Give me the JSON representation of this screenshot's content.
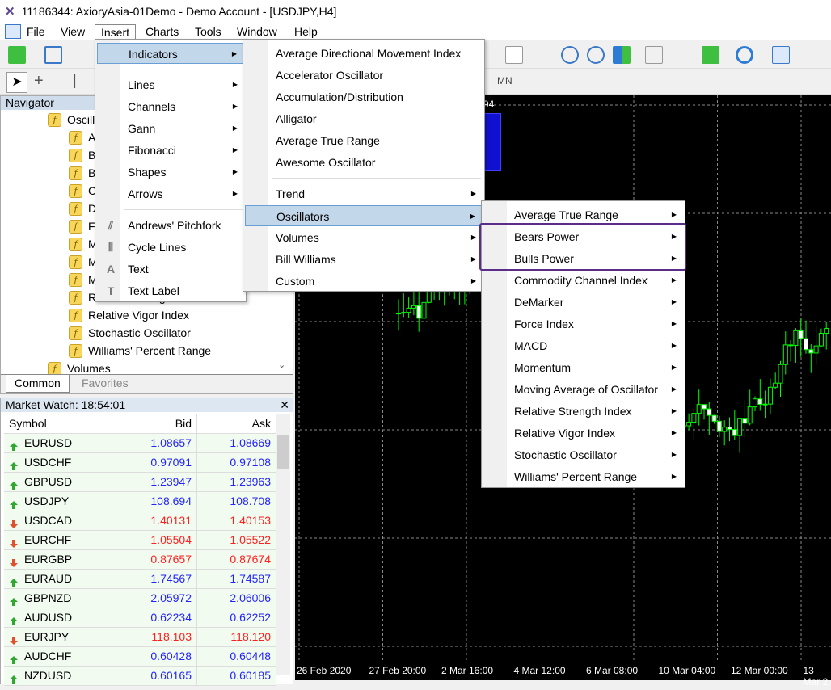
{
  "window": {
    "title": "11186344: AxioryAsia-01Demo - Demo Account - [USDJPY,H4]"
  },
  "menubar": [
    "File",
    "View",
    "Insert",
    "Charts",
    "Tools",
    "Window",
    "Help"
  ],
  "toolbar": {
    "timeframe_mn": "MN"
  },
  "navigator": {
    "title": "Navigator",
    "group": "Oscillators",
    "items": [
      "Average True Range",
      "Bears Power",
      "Bulls Power",
      "Commodity Channel Index",
      "DeMarker",
      "Force Index",
      "MACD",
      "Momentum",
      "Moving Average of Oscillator",
      "Relative Strength Index",
      "Relative Vigor Index",
      "Stochastic Oscillator",
      "Williams' Percent Range"
    ],
    "next_group": "Volumes",
    "tabs": [
      "Common",
      "Favorites"
    ]
  },
  "market_watch": {
    "title": "Market Watch: 18:54:01",
    "columns": [
      "Symbol",
      "Bid",
      "Ask"
    ],
    "rows": [
      {
        "symbol": "EURUSD",
        "bid": "1.08657",
        "ask": "1.08669",
        "dir": "up"
      },
      {
        "symbol": "USDCHF",
        "bid": "0.97091",
        "ask": "0.97108",
        "dir": "up"
      },
      {
        "symbol": "GBPUSD",
        "bid": "1.23947",
        "ask": "1.23963",
        "dir": "up"
      },
      {
        "symbol": "USDJPY",
        "bid": "108.694",
        "ask": "108.708",
        "dir": "up"
      },
      {
        "symbol": "USDCAD",
        "bid": "1.40131",
        "ask": "1.40153",
        "dir": "down"
      },
      {
        "symbol": "EURCHF",
        "bid": "1.05504",
        "ask": "1.05522",
        "dir": "down"
      },
      {
        "symbol": "EURGBP",
        "bid": "0.87657",
        "ask": "0.87674",
        "dir": "down"
      },
      {
        "symbol": "EURAUD",
        "bid": "1.74567",
        "ask": "1.74587",
        "dir": "up"
      },
      {
        "symbol": "GBPNZD",
        "bid": "2.05972",
        "ask": "2.06006",
        "dir": "up"
      },
      {
        "symbol": "AUDUSD",
        "bid": "0.62234",
        "ask": "0.62252",
        "dir": "up"
      },
      {
        "symbol": "EURJPY",
        "bid": "118.103",
        "ask": "118.120",
        "dir": "down"
      },
      {
        "symbol": "AUDCHF",
        "bid": "0.60428",
        "ask": "0.60448",
        "dir": "up"
      },
      {
        "symbol": "NZDUSD",
        "bid": "0.60165",
        "ask": "0.60185",
        "dir": "up"
      }
    ]
  },
  "chart": {
    "price_fragment": "94",
    "time_labels": [
      "26 Feb 2020",
      "27 Feb 20:00",
      "2 Mar 16:00",
      "4 Mar 12:00",
      "6 Mar 08:00",
      "10 Mar 04:00",
      "12 Mar 00:00",
      "13 Mar 2"
    ]
  },
  "insert_menu": {
    "items": [
      {
        "label": "Indicators",
        "sub": true,
        "hl": true
      },
      {
        "sep": true
      },
      {
        "label": "Lines",
        "sub": true
      },
      {
        "label": "Channels",
        "sub": true
      },
      {
        "label": "Gann",
        "sub": true
      },
      {
        "label": "Fibonacci",
        "sub": true
      },
      {
        "label": "Shapes",
        "sub": true
      },
      {
        "label": "Arrows",
        "sub": true
      },
      {
        "sep": true
      },
      {
        "label": "Andrews' Pitchfork",
        "icon": "pitchfork-icon"
      },
      {
        "label": "Cycle Lines",
        "icon": "cycle-lines-icon"
      },
      {
        "label": "Text",
        "icon": "text-icon"
      },
      {
        "label": "Text Label",
        "icon": "text-label-icon"
      }
    ]
  },
  "indicators_menu": {
    "items": [
      {
        "label": "Average Directional Movement Index"
      },
      {
        "label": "Accelerator Oscillator"
      },
      {
        "label": "Accumulation/Distribution"
      },
      {
        "label": "Alligator"
      },
      {
        "label": "Average True Range"
      },
      {
        "label": "Awesome Oscillator"
      },
      {
        "sep": true
      },
      {
        "label": "Trend",
        "sub": true
      },
      {
        "label": "Oscillators",
        "sub": true,
        "hl": true
      },
      {
        "label": "Volumes",
        "sub": true
      },
      {
        "label": "Bill Williams",
        "sub": true
      },
      {
        "label": "Custom",
        "sub": true
      }
    ]
  },
  "oscillators_menu": {
    "items": [
      "Average True Range",
      "Bears Power",
      "Bulls Power",
      "Commodity Channel Index",
      "DeMarker",
      "Force Index",
      "MACD",
      "Momentum",
      "Moving Average of Oscillator",
      "Relative Strength Index",
      "Relative Vigor Index",
      "Stochastic Oscillator",
      "Williams' Percent Range"
    ],
    "highlight_color": "#5b2d8a"
  },
  "colors": {
    "bid_up": "#2424ff",
    "bid_down": "#ff2020",
    "candle": "#00ff00",
    "menu_highlight": "#c3d7ea"
  }
}
